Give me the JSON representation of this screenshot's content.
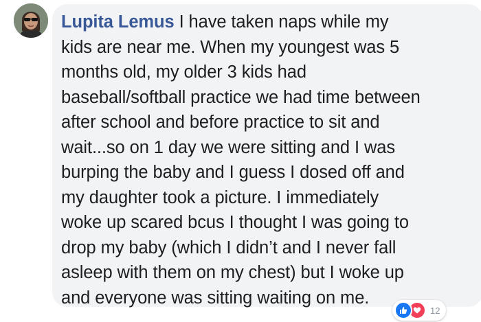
{
  "comment": {
    "author": "Lupita Lemus",
    "lines": [
      " I have taken naps while my",
      "kids are near me. When my youngest was 5",
      "months old, my older 3 kids had",
      "baseball/softball practice we had time between",
      "after school and before practice to sit and",
      "wait...so on 1 day we were sitting and I was",
      "burping the baby and I guess I dosed off and",
      "my daughter took a picture. I immediately",
      "woke up scared bcus I thought I was going to",
      "drop my baby (which I didn’t and I never fall",
      "asleep with them on my chest) but I woke up",
      "and everyone was sitting waiting on me."
    ]
  },
  "reactions": {
    "icons": [
      "like-icon",
      "love-icon"
    ],
    "count": "12",
    "colors": {
      "like": "#1877f2",
      "love": "#f33e58"
    }
  },
  "colors": {
    "author": "#385898",
    "bubble": "#f2f3f5",
    "text": "#1c1e21"
  }
}
